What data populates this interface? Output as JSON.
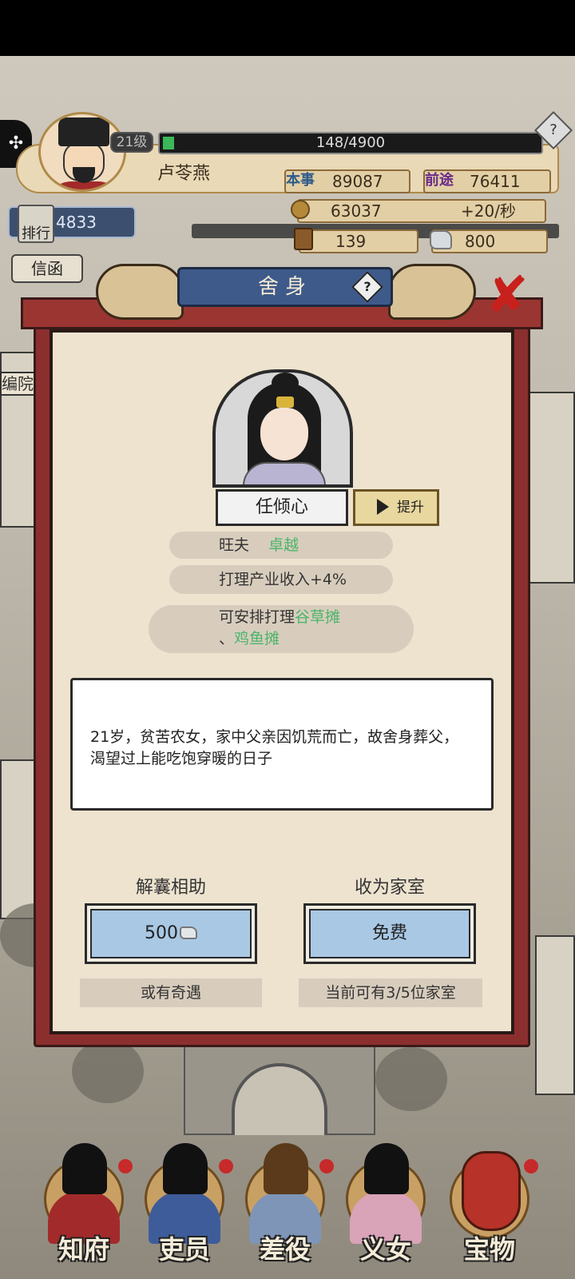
{
  "hud": {
    "level": "21级",
    "xp_text": "148/4900",
    "xp_fraction": 0.0302,
    "player_name": "卢苓燕",
    "ability_label": "本事",
    "ability_value": "89087",
    "prestige_label": "前途",
    "prestige_value": "76411",
    "coins": "63037",
    "coin_rate": "+20/秒",
    "seals": "139",
    "silver": "800",
    "rank_value": "4833",
    "rank_label": "排行",
    "mail_label": "信函",
    "help_symbol": "?"
  },
  "side_tab": {
    "icon": "puzzle-icon"
  },
  "scene": {
    "building_label": "编院"
  },
  "modal": {
    "title": "舍身",
    "help_symbol": "?",
    "close_symbol": "✘",
    "character": {
      "name": "任倾心",
      "upgrade_label": "提升",
      "trait_name": "旺夫",
      "trait_grade": "卓越",
      "bonus": "打理产业收入+4%",
      "manage_prefix": "可安排打理",
      "manage_item1": "谷草摊",
      "manage_sep": "、",
      "manage_item2": "鸡鱼摊"
    },
    "description": "21岁，贫苦农女，家中父亲因饥荒而亡，故舍身葬父，渴望过上能吃饱穿暖的日子",
    "options": [
      {
        "label": "解囊相助",
        "button": "500",
        "caption": "或有奇遇"
      },
      {
        "label": "收为家室",
        "button": "免费",
        "caption": "当前可有3/5位家室"
      }
    ]
  },
  "nav": [
    {
      "label": "知府"
    },
    {
      "label": "吏员"
    },
    {
      "label": "差役"
    },
    {
      "label": "义女"
    },
    {
      "label": "宝物"
    }
  ],
  "colors": {
    "accent_green": "#4bb56b",
    "frame_red": "#8b2f2e",
    "title_blue": "#3e5a8a",
    "button_blue": "#a9c8e4",
    "close_red": "#c8201c"
  }
}
